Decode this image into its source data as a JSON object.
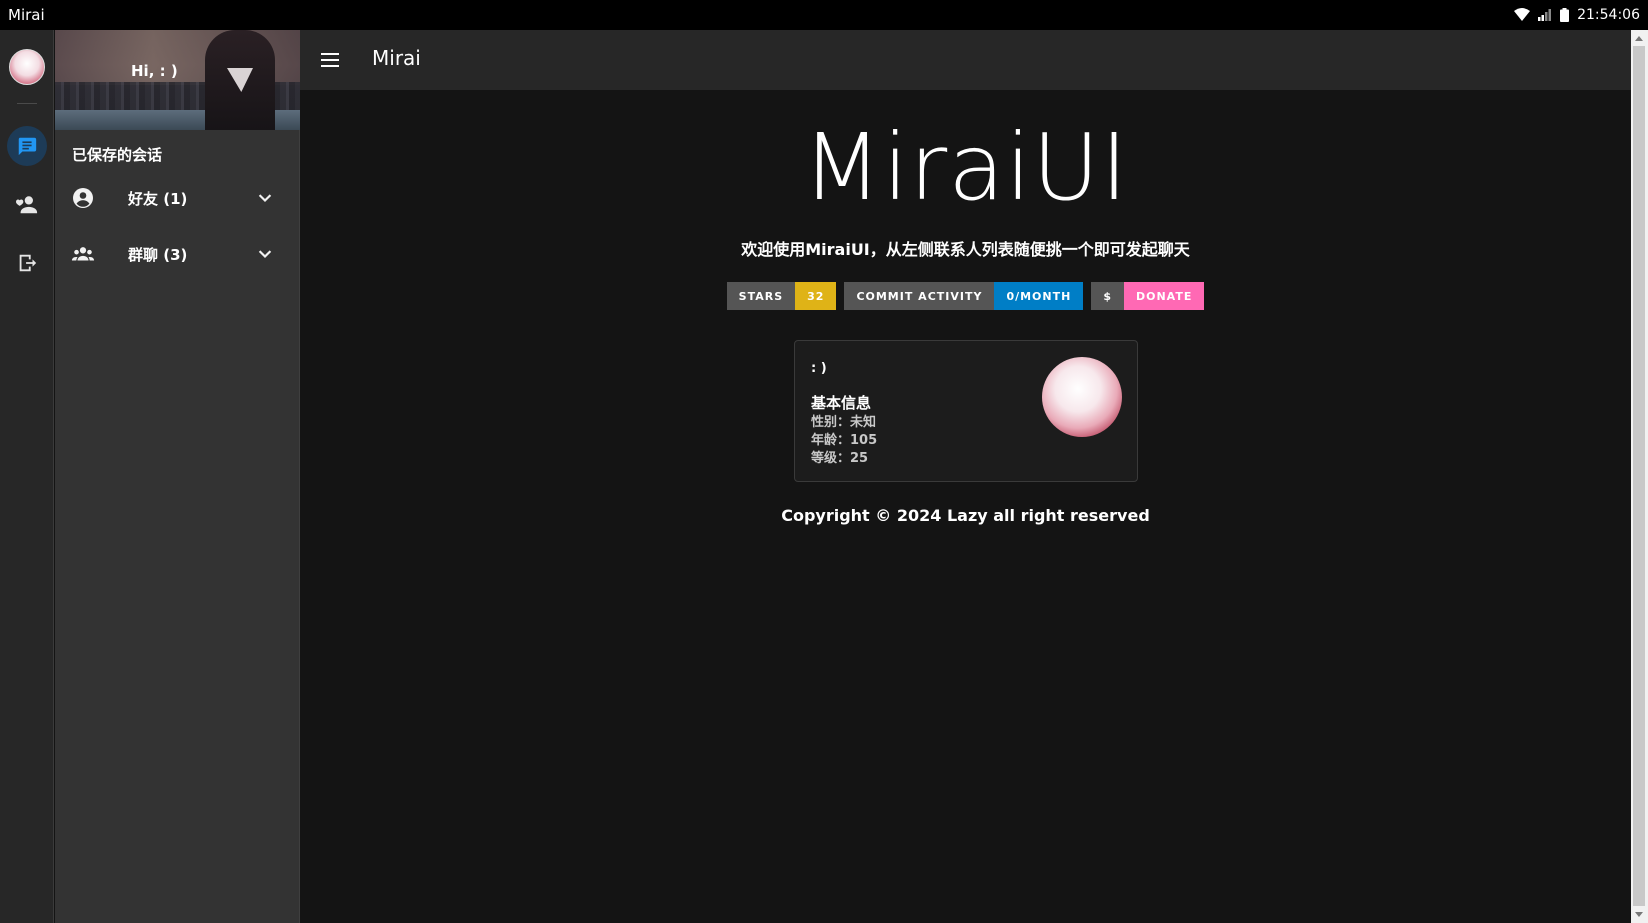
{
  "os": {
    "app_name": "Mirai",
    "time": "21:54:06",
    "icons": [
      "wifi-icon",
      "signal-icon",
      "battery-icon"
    ]
  },
  "rail": {
    "items": [
      {
        "name": "chat-icon",
        "active": true
      },
      {
        "name": "add-friend-icon",
        "active": false
      },
      {
        "name": "logout-icon",
        "active": false
      }
    ]
  },
  "drawer": {
    "greeting": "Hi, : )",
    "saved_title": "已保存的会话",
    "groups": [
      {
        "label": "好友 (1)",
        "icon": "account-circle-icon"
      },
      {
        "label": "群聊 (3)",
        "icon": "group-icon"
      }
    ]
  },
  "topbar": {
    "title": "Mirai"
  },
  "main": {
    "hero": "MiraiUI",
    "welcome": "欢迎使用MiraiUI，从左侧联系人列表随便挑一个即可发起聊天",
    "badges": [
      {
        "label": "STARS",
        "value": "32",
        "color": "#dfb317"
      },
      {
        "label": "COMMIT ACTIVITY",
        "value": "0/MONTH",
        "color": "#007ec6"
      },
      {
        "label": "$",
        "value": "DONATE",
        "color": "#ff69b4"
      }
    ],
    "profile": {
      "nickname": ": )",
      "section": "基本信息",
      "gender": "性别：未知",
      "age": "年龄：105",
      "level": "等级：25"
    },
    "copyright": "Copyright © 2024 Lazy all right reserved"
  },
  "colors": {
    "background": "#141414",
    "surface": "#272727",
    "drawer": "#333333",
    "accent": "#1e88e5"
  }
}
